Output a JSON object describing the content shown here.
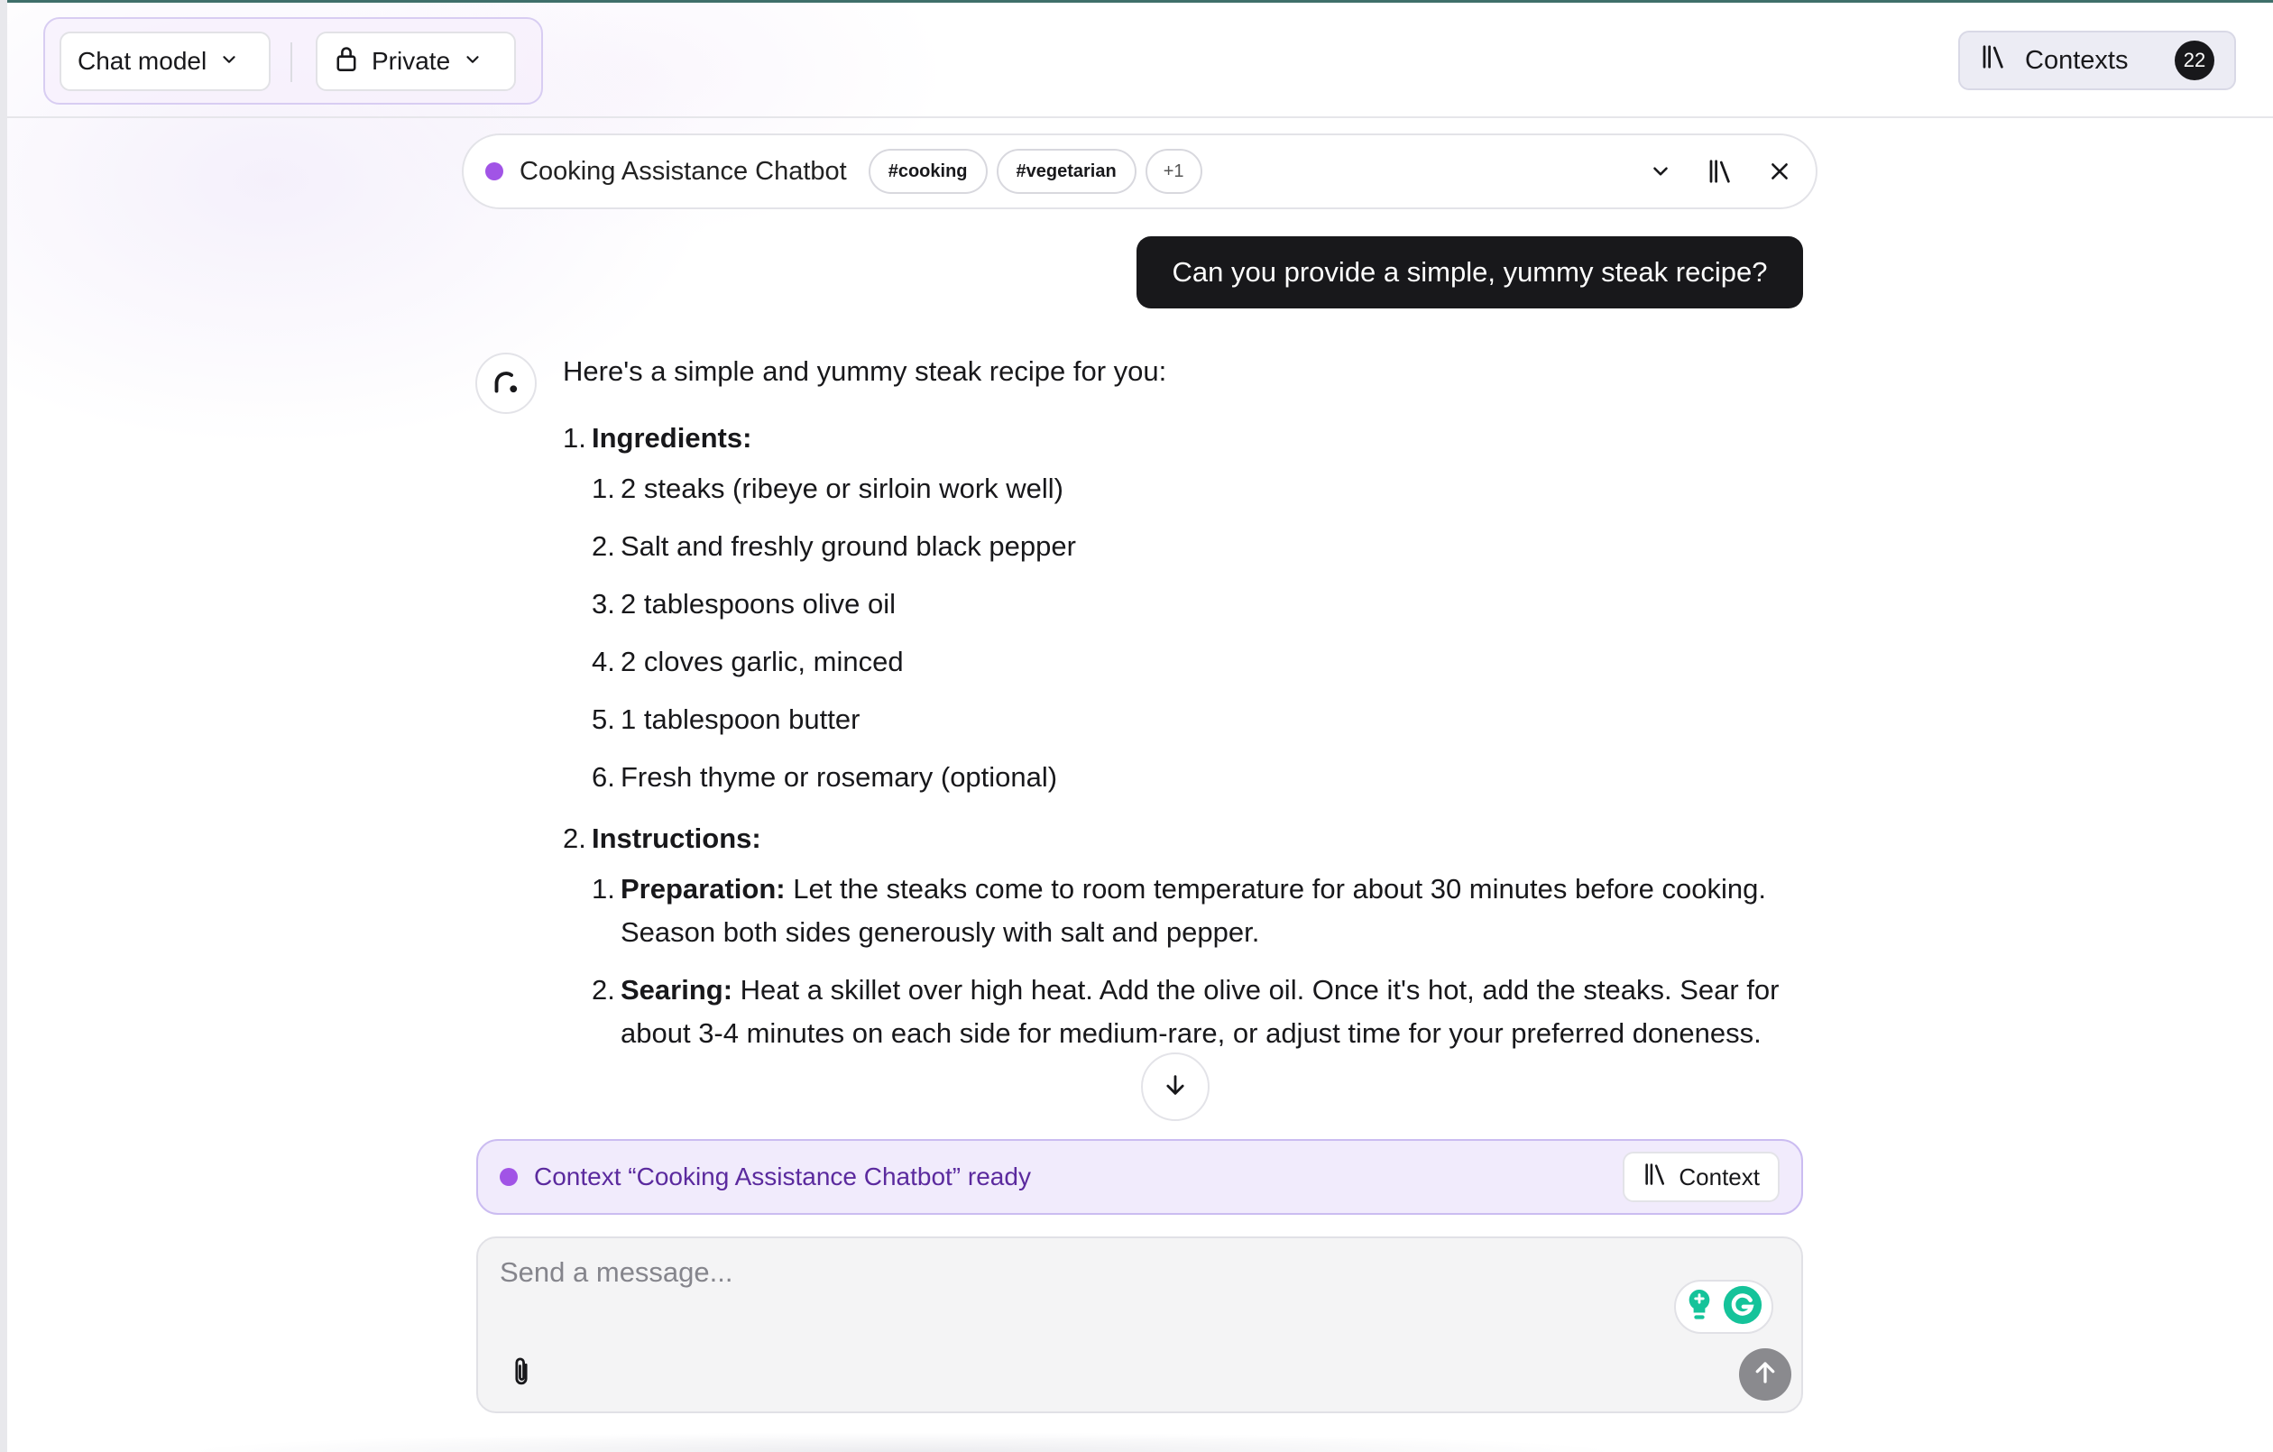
{
  "header": {
    "model_selector_label": "Chat model",
    "visibility_label": "Private",
    "contexts_label": "Contexts",
    "contexts_count": "22"
  },
  "context_bar": {
    "title": "Cooking Assistance Chatbot",
    "tags": [
      "#cooking",
      "#vegetarian"
    ],
    "more_tags": "+1",
    "status_color": "#a154e6"
  },
  "conversation": {
    "user_message": "Can you provide a simple, yummy steak recipe?",
    "assistant": {
      "intro": "Here's a simple and yummy steak recipe for you:",
      "sections": [
        {
          "num": "1.",
          "heading": "Ingredients:",
          "items": [
            {
              "num": "1.",
              "bold": "",
              "text": "2 steaks (ribeye or sirloin work well)"
            },
            {
              "num": "2.",
              "bold": "",
              "text": "Salt and freshly ground black pepper"
            },
            {
              "num": "3.",
              "bold": "",
              "text": "2 tablespoons olive oil"
            },
            {
              "num": "4.",
              "bold": "",
              "text": "2 cloves garlic, minced"
            },
            {
              "num": "5.",
              "bold": "",
              "text": "1 tablespoon butter"
            },
            {
              "num": "6.",
              "bold": "",
              "text": "Fresh thyme or rosemary (optional)"
            }
          ]
        },
        {
          "num": "2.",
          "heading": "Instructions:",
          "items": [
            {
              "num": "1.",
              "bold": "Preparation:",
              "text": "Let the steaks come to room temperature for about 30 minutes before cooking. Season both sides generously with salt and pepper."
            },
            {
              "num": "2.",
              "bold": "Searing:",
              "text": "Heat a skillet over high heat. Add the olive oil. Once it's hot, add the steaks. Sear for about 3-4 minutes on each side for medium-rare, or adjust time for your preferred doneness."
            }
          ]
        }
      ]
    }
  },
  "banner": {
    "text": "Context “Cooking Assistance Chatbot” ready",
    "button_label": "Context"
  },
  "composer": {
    "placeholder": "Send a message...",
    "value": ""
  },
  "colors": {
    "accent_purple": "#a154e6",
    "banner_bg": "#f1ebfc",
    "user_bubble": "#18181b",
    "grammarly_green": "#15c39a"
  }
}
